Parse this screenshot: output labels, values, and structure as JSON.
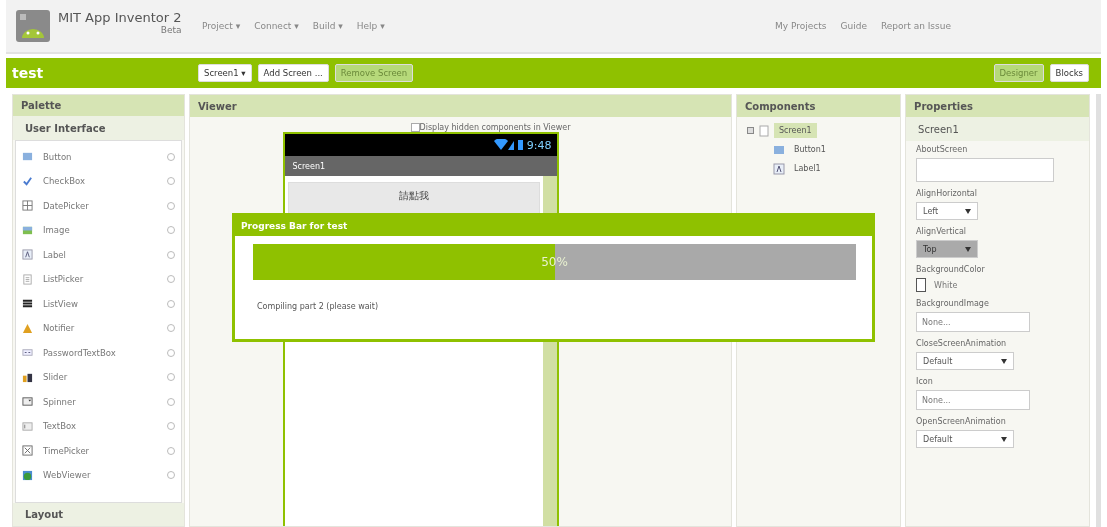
{
  "header": {
    "title": "MIT App Inventor 2",
    "subtitle": "Beta",
    "menu": [
      "Project ▾",
      "Connect ▾",
      "Build ▾",
      "Help ▾"
    ],
    "links": [
      "My Projects",
      "Guide",
      "Report an Issue"
    ]
  },
  "toolbar": {
    "project": "test",
    "buttons": [
      {
        "label": "Screen1 ▾",
        "disabled": false
      },
      {
        "label": "Add Screen ...",
        "disabled": false
      },
      {
        "label": "Remove Screen",
        "disabled": true
      }
    ],
    "views": [
      {
        "label": "Designer",
        "selected": true
      },
      {
        "label": "Blocks",
        "selected": false
      }
    ]
  },
  "palette": {
    "title": "Palette",
    "section": "User Interface",
    "items": [
      {
        "label": "Button",
        "kind": "button"
      },
      {
        "label": "CheckBox",
        "kind": "checkbox"
      },
      {
        "label": "DatePicker",
        "kind": "datepicker"
      },
      {
        "label": "Image",
        "kind": "image"
      },
      {
        "label": "Label",
        "kind": "label"
      },
      {
        "label": "ListPicker",
        "kind": "listpicker"
      },
      {
        "label": "ListView",
        "kind": "listview"
      },
      {
        "label": "Notifier",
        "kind": "notifier"
      },
      {
        "label": "PasswordTextBox",
        "kind": "password"
      },
      {
        "label": "Slider",
        "kind": "slider"
      },
      {
        "label": "Spinner",
        "kind": "spinner"
      },
      {
        "label": "TextBox",
        "kind": "textbox"
      },
      {
        "label": "TimePicker",
        "kind": "timepicker"
      },
      {
        "label": "WebViewer",
        "kind": "webviewer"
      }
    ],
    "next_section": "Layout"
  },
  "viewer": {
    "title": "Viewer",
    "hidden_toggle": {
      "label": "Display hidden components in Viewer",
      "checked": false
    },
    "phone": {
      "time": "9:48",
      "screen_title": "Screen1",
      "button_label": "請點我"
    }
  },
  "progress_dialog": {
    "title": "Progress Bar for test",
    "level": 0.5,
    "percent": "50%",
    "message": "Compiling part 2 (please wait)"
  },
  "components": {
    "title": "Components",
    "tree": [
      {
        "label": "Screen1",
        "kind": "screen",
        "selected": true,
        "expanded": true,
        "children": [
          {
            "label": "Button1",
            "kind": "button",
            "selected": false
          },
          {
            "label": "Label1",
            "kind": "label",
            "selected": false
          }
        ]
      }
    ]
  },
  "properties": {
    "title": "Properties",
    "component": "Screen1",
    "items": [
      {
        "label": "AboutScreen",
        "kind": "textarea"
      },
      {
        "label": "AlignHorizontal",
        "kind": "select",
        "value": "Left",
        "disabled": false
      },
      {
        "label": "AlignVertical",
        "kind": "select",
        "value": "Top",
        "disabled": true
      },
      {
        "label": "BackgroundColor",
        "kind": "color",
        "value": "White"
      },
      {
        "label": "BackgroundImage",
        "kind": "picker",
        "value": "None..."
      },
      {
        "label": "CloseScreenAnimation",
        "kind": "select",
        "value": "Default",
        "disabled": false,
        "wide": true
      },
      {
        "label": "Icon",
        "kind": "picker",
        "value": "None..."
      },
      {
        "label": "OpenScreenAnimation",
        "kind": "select",
        "value": "Default",
        "disabled": false,
        "wide": true
      }
    ]
  }
}
